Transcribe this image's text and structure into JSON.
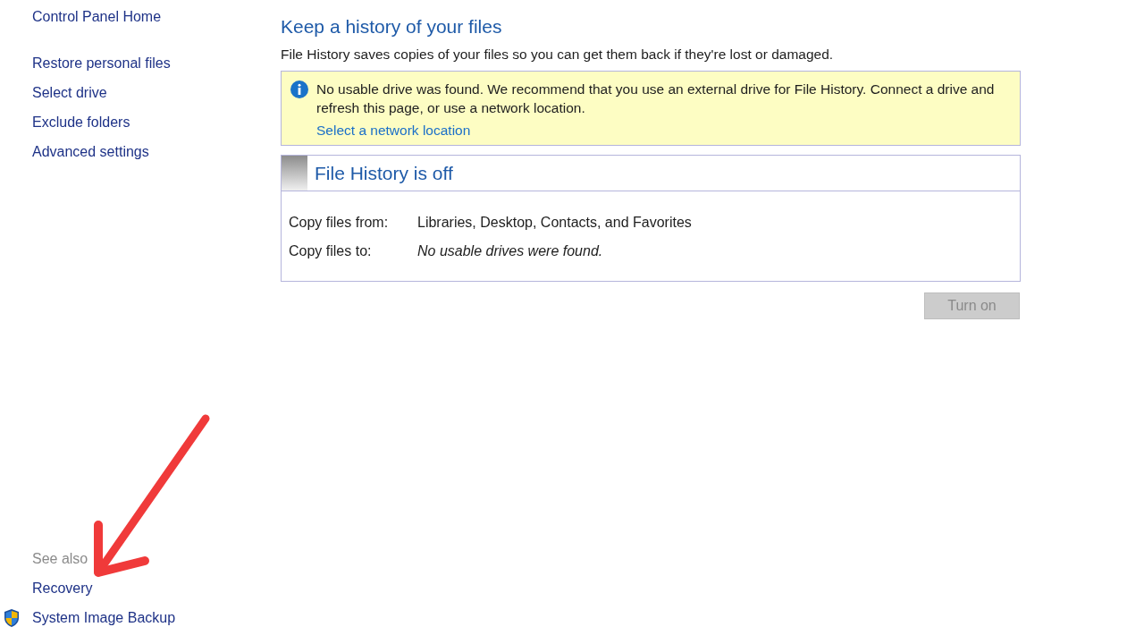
{
  "sidebar": {
    "home_link": "Control Panel Home",
    "links": [
      "Restore personal files",
      "Select drive",
      "Exclude folders",
      "Advanced settings"
    ],
    "see_also": {
      "heading": "See also",
      "links": [
        {
          "label": "Recovery",
          "kind": "plain"
        },
        {
          "label": "System Image Backup",
          "kind": "shield"
        }
      ]
    }
  },
  "main": {
    "title": "Keep a history of your files",
    "description": "File History saves copies of your files so you can get them back if they're lost or damaged.",
    "notice": {
      "message": "No usable drive was found. We recommend that you use an external drive for File History. Connect a drive and refresh this page, or use a network location.",
      "link": "Select a network location"
    },
    "status_panel": {
      "title": "File History is off",
      "rows": [
        {
          "label": "Copy files from:",
          "value": "Libraries, Desktop, Contacts, and Favorites",
          "kind": "normal"
        },
        {
          "label": "Copy files to:",
          "value": "No usable drives were found.",
          "kind": "italic"
        }
      ]
    },
    "button": {
      "label": "Turn on",
      "disabled": true
    }
  },
  "annotation": {
    "kind": "arrow"
  }
}
